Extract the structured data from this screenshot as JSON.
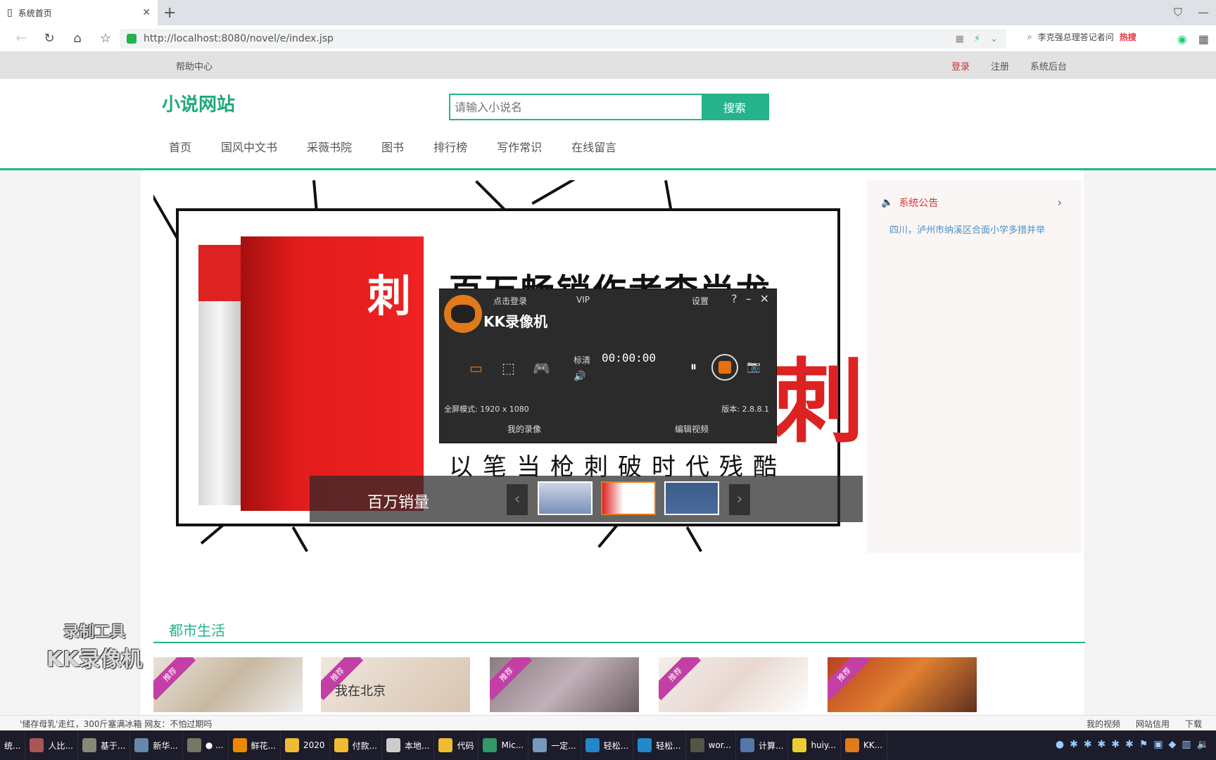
{
  "browser": {
    "tab_title": "系统首页",
    "url": "http://localhost:8080/novel/e/index.jsp",
    "search_hint": "李克强总理答记者问",
    "hot_label": "热搜"
  },
  "site": {
    "help": "帮助中心",
    "top_links": [
      "登录",
      "注册",
      "系统后台"
    ],
    "logo": "小说网站",
    "search_placeholder": "请输入小说名",
    "search_button": "搜索",
    "nav": [
      "首页",
      "国风中文书",
      "采薇书院",
      "图书",
      "排行榜",
      "写作常识",
      "在线留言"
    ]
  },
  "banner": {
    "book_char": "刺",
    "headline": "百万畅销作者李尚龙",
    "big_char": "刺",
    "slogan": "以笔当枪刺破时代残酷",
    "caption": "百万销量",
    "prev": "‹",
    "next": "›"
  },
  "notice": {
    "title": "系统公告",
    "items": [
      "四川，泸州市纳溪区合面小学多措并举"
    ]
  },
  "recorder": {
    "login": "点击登录",
    "vip": "VIP",
    "title": "KK录像机",
    "settings": "设置",
    "quality": "标清",
    "time": "00:00:00",
    "fullscreen": "全屏模式: 1920 x 1080",
    "version": "版本: 2.8.8.1",
    "my_videos": "我的录像",
    "edit_video": "编辑视频"
  },
  "section": {
    "title": "都市生活",
    "ribbon": "推荐",
    "books": [
      "",
      "我在北京",
      "",
      "",
      ""
    ]
  },
  "watermark": {
    "line1": "录制工具",
    "line2": "KK录像机"
  },
  "statusbar": {
    "news": "'储存母乳'走红，300斤塞满冰箱  网友：不怕过期吗",
    "right": [
      "我的视频",
      "网站信用",
      "下载"
    ]
  },
  "taskbar": [
    "统...",
    "人比...",
    "基于...",
    "新华...",
    "● ...",
    "鲜花...",
    "2020",
    "付款...",
    "本地...",
    "代码",
    "Mic...",
    "一定...",
    "轻松...",
    "轻松...",
    "wor...",
    "计算...",
    "huiy...",
    "KK..."
  ]
}
